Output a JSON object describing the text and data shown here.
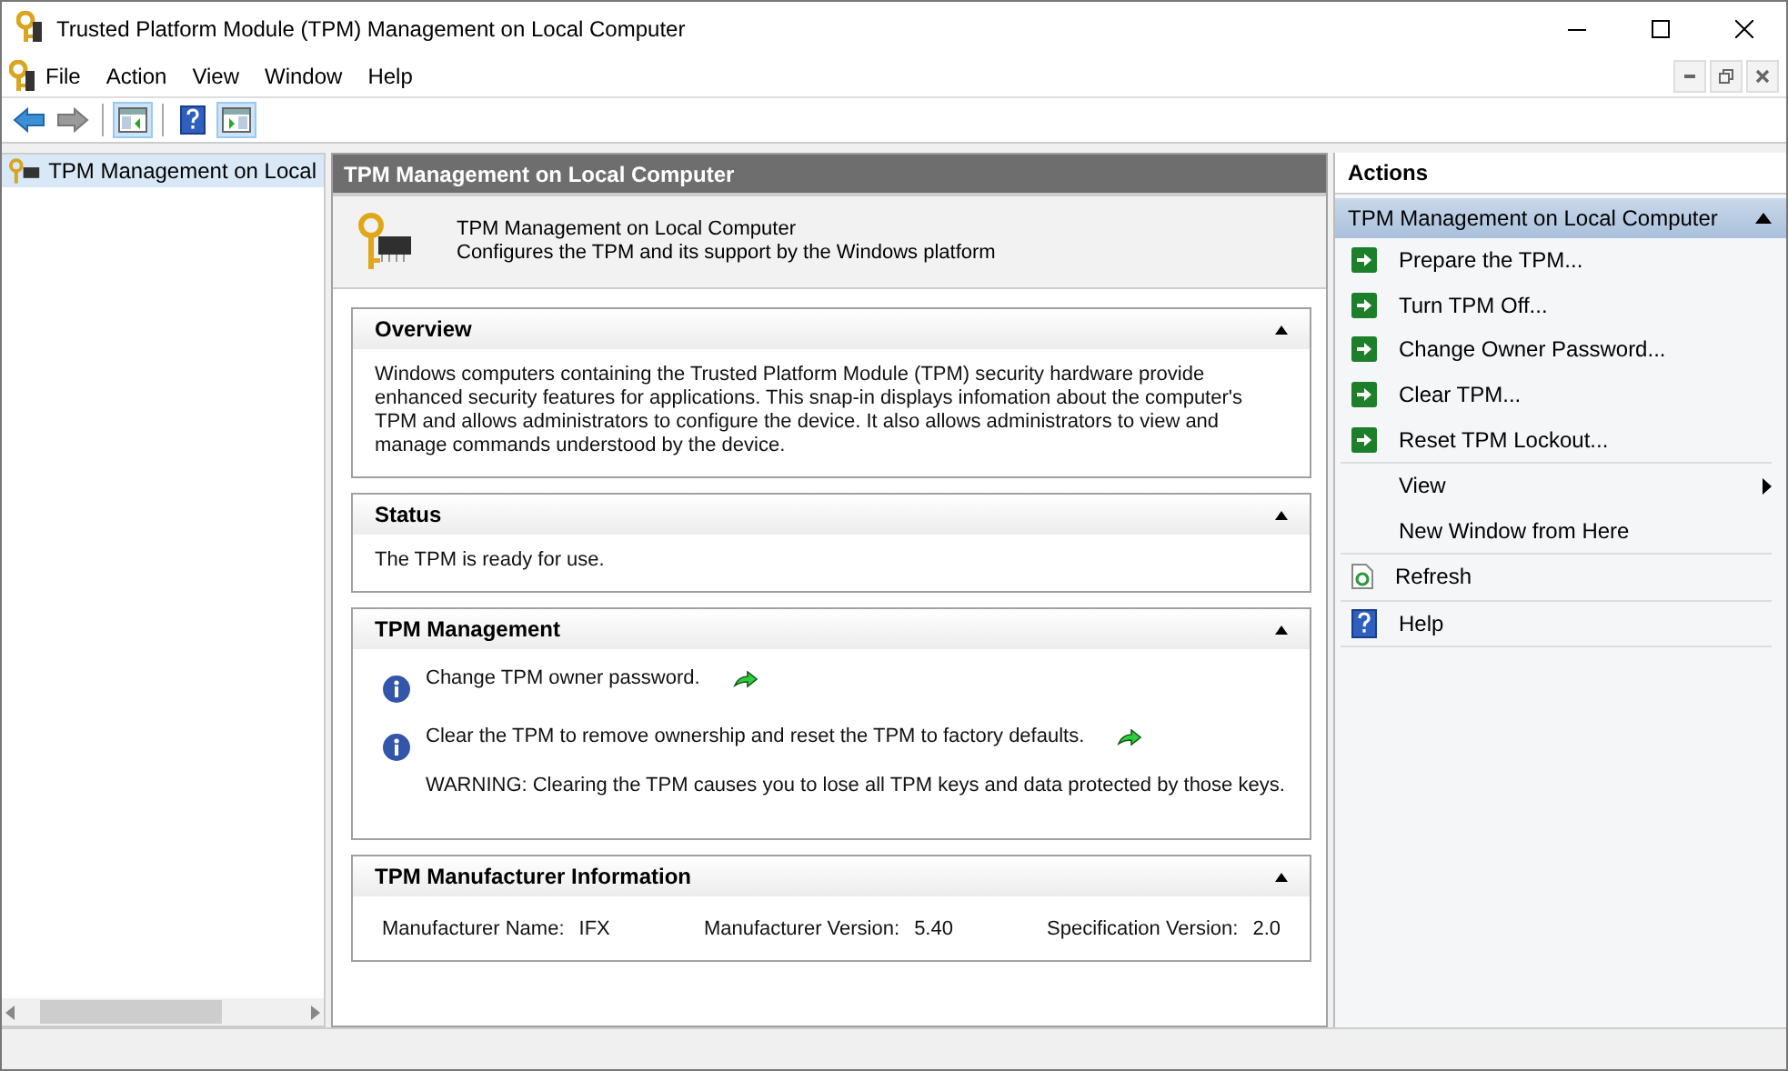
{
  "window": {
    "title": "Trusted Platform Module (TPM) Management on Local Computer"
  },
  "menu": [
    "File",
    "Action",
    "View",
    "Window",
    "Help"
  ],
  "toolbar": [
    {
      "kind": "back",
      "pressed": false
    },
    {
      "kind": "forward",
      "pressed": false
    },
    {
      "kind": "tree",
      "pressed": true
    },
    {
      "kind": "help",
      "pressed": false
    },
    {
      "kind": "actionpane",
      "pressed": true
    }
  ],
  "tree": [
    {
      "label": "TPM Management on Local",
      "selected": true
    }
  ],
  "center": {
    "header": "TPM Management on Local Computer",
    "title": "TPM Management on Local Computer",
    "subtitle": "Configures the TPM and its support by the Windows platform",
    "sections": [
      {
        "kind": "text",
        "title": "Overview",
        "expanded": true,
        "text": "Windows computers containing the Trusted Platform Module (TPM) security hardware provide enhanced security features for applications. This snap-in displays infomation about the computer's TPM and allows administrators to configure the device. It also allows administrators to view and manage commands understood by the device."
      },
      {
        "kind": "text",
        "title": "Status",
        "expanded": true,
        "text": "The TPM is ready for use."
      },
      {
        "kind": "tasks",
        "title": "TPM Management",
        "expanded": true,
        "tasks": [
          {
            "text": "Change TPM owner password."
          },
          {
            "text": "Clear the TPM to remove ownership and reset the TPM to factory defaults.",
            "note": "WARNING: Clearing the TPM causes you to lose all TPM keys and data protected by those keys."
          }
        ]
      },
      {
        "kind": "fields",
        "title": "TPM Manufacturer Information",
        "expanded": true,
        "fields": [
          {
            "label": "Manufacturer Name:",
            "value": "IFX"
          },
          {
            "label": "Manufacturer Version:",
            "value": "5.40"
          },
          {
            "label": "Specification Version:",
            "value": "2.0"
          }
        ]
      }
    ]
  },
  "actions": {
    "title": "Actions",
    "group": {
      "title": "TPM Management on Local Computer",
      "expanded": true
    },
    "groups": [
      [
        {
          "kind": "run",
          "label": "Prepare the TPM..."
        },
        {
          "kind": "run",
          "label": "Turn TPM Off..."
        },
        {
          "kind": "run",
          "label": "Change Owner Password..."
        },
        {
          "kind": "run",
          "label": "Clear TPM..."
        },
        {
          "kind": "run",
          "label": "Reset TPM Lockout..."
        }
      ],
      [
        {
          "kind": "submenu",
          "label": "View"
        },
        {
          "kind": "plain",
          "label": "New Window from Here"
        }
      ],
      [
        {
          "kind": "refresh",
          "label": "Refresh"
        }
      ],
      [
        {
          "kind": "help",
          "label": "Help"
        }
      ]
    ]
  }
}
